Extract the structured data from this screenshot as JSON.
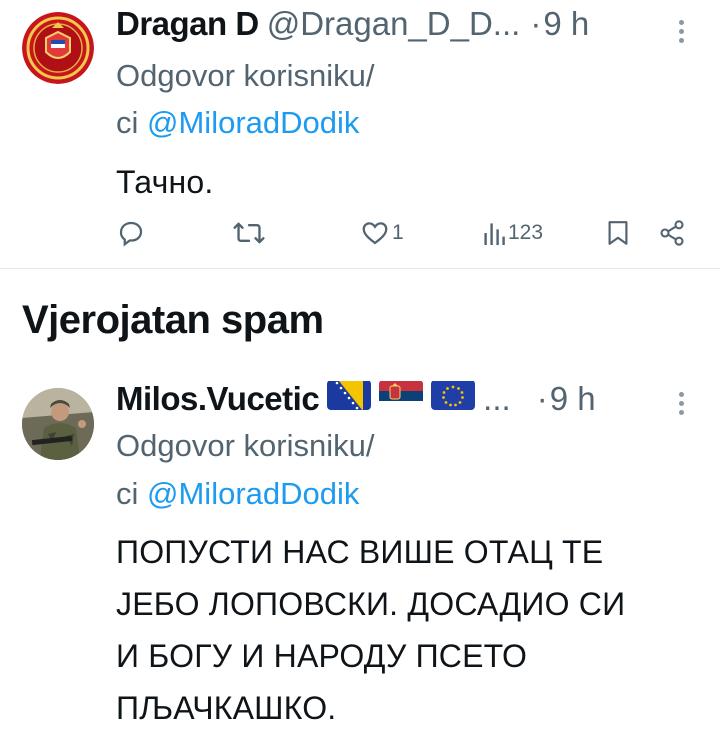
{
  "tweets": [
    {
      "display_name": "Dragan D",
      "handle": "@Dragan_D_D...",
      "dot": "·",
      "time": "9 h",
      "reply_prefix": "Odgovor korisniku/",
      "reply_ci": "ci",
      "reply_mention": "@MiloradDodik",
      "text": "Тачно.",
      "avatar": "red-coat-of-arms-avatar",
      "actions": {
        "reply_icon": "reply-icon",
        "retweet_icon": "retweet-icon",
        "like_icon": "like-icon",
        "like_count": "1",
        "views_icon": "views-icon",
        "views_count": "123",
        "bookmark_icon": "bookmark-icon",
        "share_icon": "share-icon"
      }
    },
    {
      "display_name": "Milos.Vucetic",
      "flags": [
        "bosnia-flag-icon",
        "serbia-flag-icon",
        "eu-flag-icon"
      ],
      "ellipsis": "...",
      "dot": "·",
      "time": "9 h",
      "reply_prefix": "Odgovor korisniku/",
      "reply_ci": "ci",
      "reply_mention": "@MiloradDodik",
      "text_lines": [
        "ПОПУСТИ НАС ВИШЕ ОТАЦ ТЕ",
        "ЈЕБО ЛОПОВСКИ. ДОСАДИО СИ",
        "И БОГУ И НАРОДУ ПСЕТО",
        "ПЉАЧКАШКО."
      ],
      "avatar": "soldier-photo-avatar"
    }
  ],
  "section_title": "Vjerojatan spam",
  "colors": {
    "text": "#0f1419",
    "secondary": "#536471",
    "mention": "#1d9bf0",
    "divider": "#e6e9eb"
  }
}
